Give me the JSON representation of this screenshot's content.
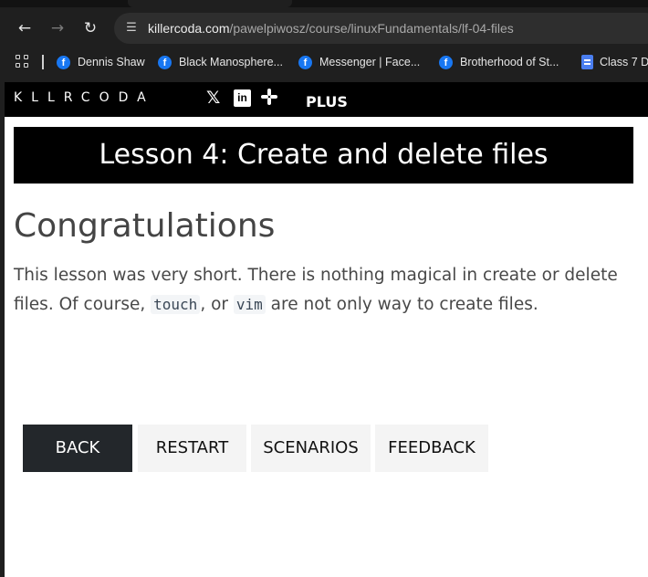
{
  "browser": {
    "url_host": "killercoda.com",
    "url_path": "/pawelpiwosz/course/linuxFundamentals/lf-04-files",
    "bookmarks": [
      {
        "label": "Dennis Shaw",
        "icon": "facebook-icon"
      },
      {
        "label": "Black Manosphere...",
        "icon": "facebook-icon"
      },
      {
        "label": "Messenger | Face...",
        "icon": "facebook-icon"
      },
      {
        "label": "Brotherhood of St...",
        "icon": "facebook-icon"
      },
      {
        "label": "Class 7 D",
        "icon": "doc-icon"
      }
    ]
  },
  "site": {
    "logo": "KLLRCODA",
    "plus_label": "PLUS"
  },
  "lesson": {
    "banner": "Lesson 4: Create and delete files",
    "heading": "Congratulations",
    "text_1": "This lesson was very short. There is nothing magical in create or delete files. Of course, ",
    "code_1": "touch",
    "text_2": ", or ",
    "code_2": "vim",
    "text_3": " are not only way to create files."
  },
  "actions": {
    "back": "BACK",
    "restart": "RESTART",
    "scenarios": "SCENARIOS",
    "feedback": "FEEDBACK"
  },
  "colors": {
    "header_bg": "#000000",
    "back_button_bg": "#23272b",
    "secondary_button_bg": "#f4f4f4",
    "facebook_blue": "#1877f2"
  }
}
